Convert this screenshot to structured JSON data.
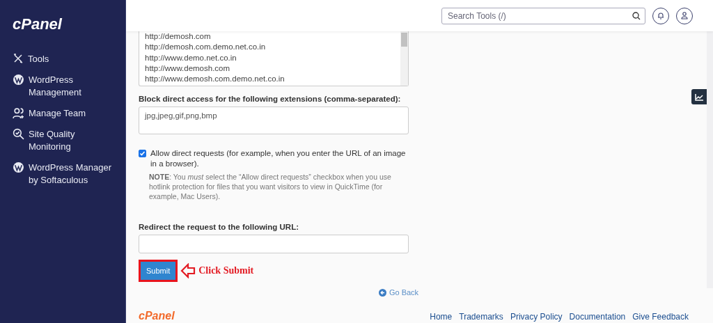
{
  "sidebar": {
    "logo": "cPanel",
    "items": [
      {
        "kind": "tools",
        "label": "Tools"
      },
      {
        "kind": "wordpress",
        "label": "WordPress Management"
      },
      {
        "kind": "team",
        "label": "Manage Team"
      },
      {
        "kind": "quality",
        "label": "Site Quality Monitoring"
      },
      {
        "kind": "wordpress",
        "label": "WordPress Manager by Softaculous"
      }
    ]
  },
  "header": {
    "search": {
      "placeholder": "Search Tools (/)"
    }
  },
  "form": {
    "referrers": [
      "http://demosh.com",
      "http://demosh.com.demo.net.co.in",
      "http://www.demo.net.co.in",
      "http://www.demosh.com",
      "http://www.demosh.com.demo.net.co.in"
    ],
    "extensions_label": "Block direct access for the following extensions (comma-separated):",
    "extensions_value": "jpg,jpeg,gif,png,bmp",
    "allow_direct": {
      "checked": true,
      "label": "Allow direct requests (for example, when you enter the URL of an image in a browser).",
      "note": "**NOTE**: You *must* select the “Allow direct requests” checkbox when you use hotlink protection for files that you want visitors to view in QuickTime (for example, Mac Users)."
    },
    "redirect_label": "Redirect the request to the following URL:",
    "submit": "Submit",
    "annotation": "Click Submit"
  },
  "go_back": "Go Back",
  "footer": {
    "logo": "cPanel",
    "links": [
      "Home",
      "Trademarks",
      "Privacy Policy",
      "Documentation",
      "Give Feedback"
    ]
  }
}
